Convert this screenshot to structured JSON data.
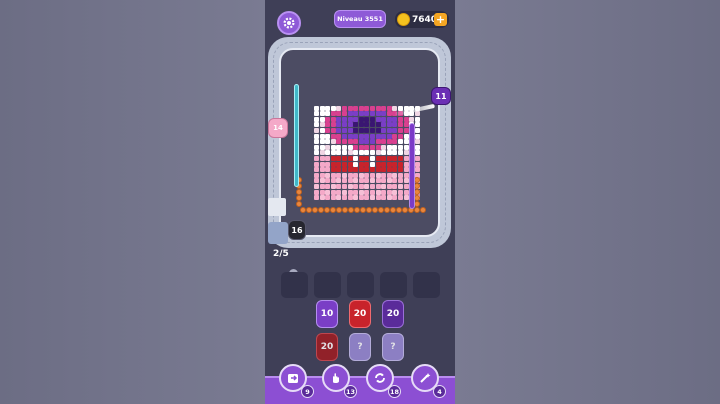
{
  "hud": {
    "level_label": "Niveau 3551",
    "coins": "7640",
    "coin_plus": "+"
  },
  "board": {
    "shooter_purple_count": "11",
    "shooter_pink_count": "14",
    "shooter_black_count": "16",
    "progress": "2/5"
  },
  "queue": {
    "row1": [
      "10",
      "20",
      "20"
    ],
    "row2": [
      "20",
      "?",
      "?"
    ]
  },
  "boosters": {
    "counts": [
      "9",
      "13",
      "18",
      "4"
    ]
  },
  "colors": {
    "purple": "#7a3ec6",
    "red": "#c8232b",
    "pink": "#f4a9c8",
    "black": "#26262f",
    "cyan": "#41b8c8",
    "orange": "#e8863e"
  }
}
